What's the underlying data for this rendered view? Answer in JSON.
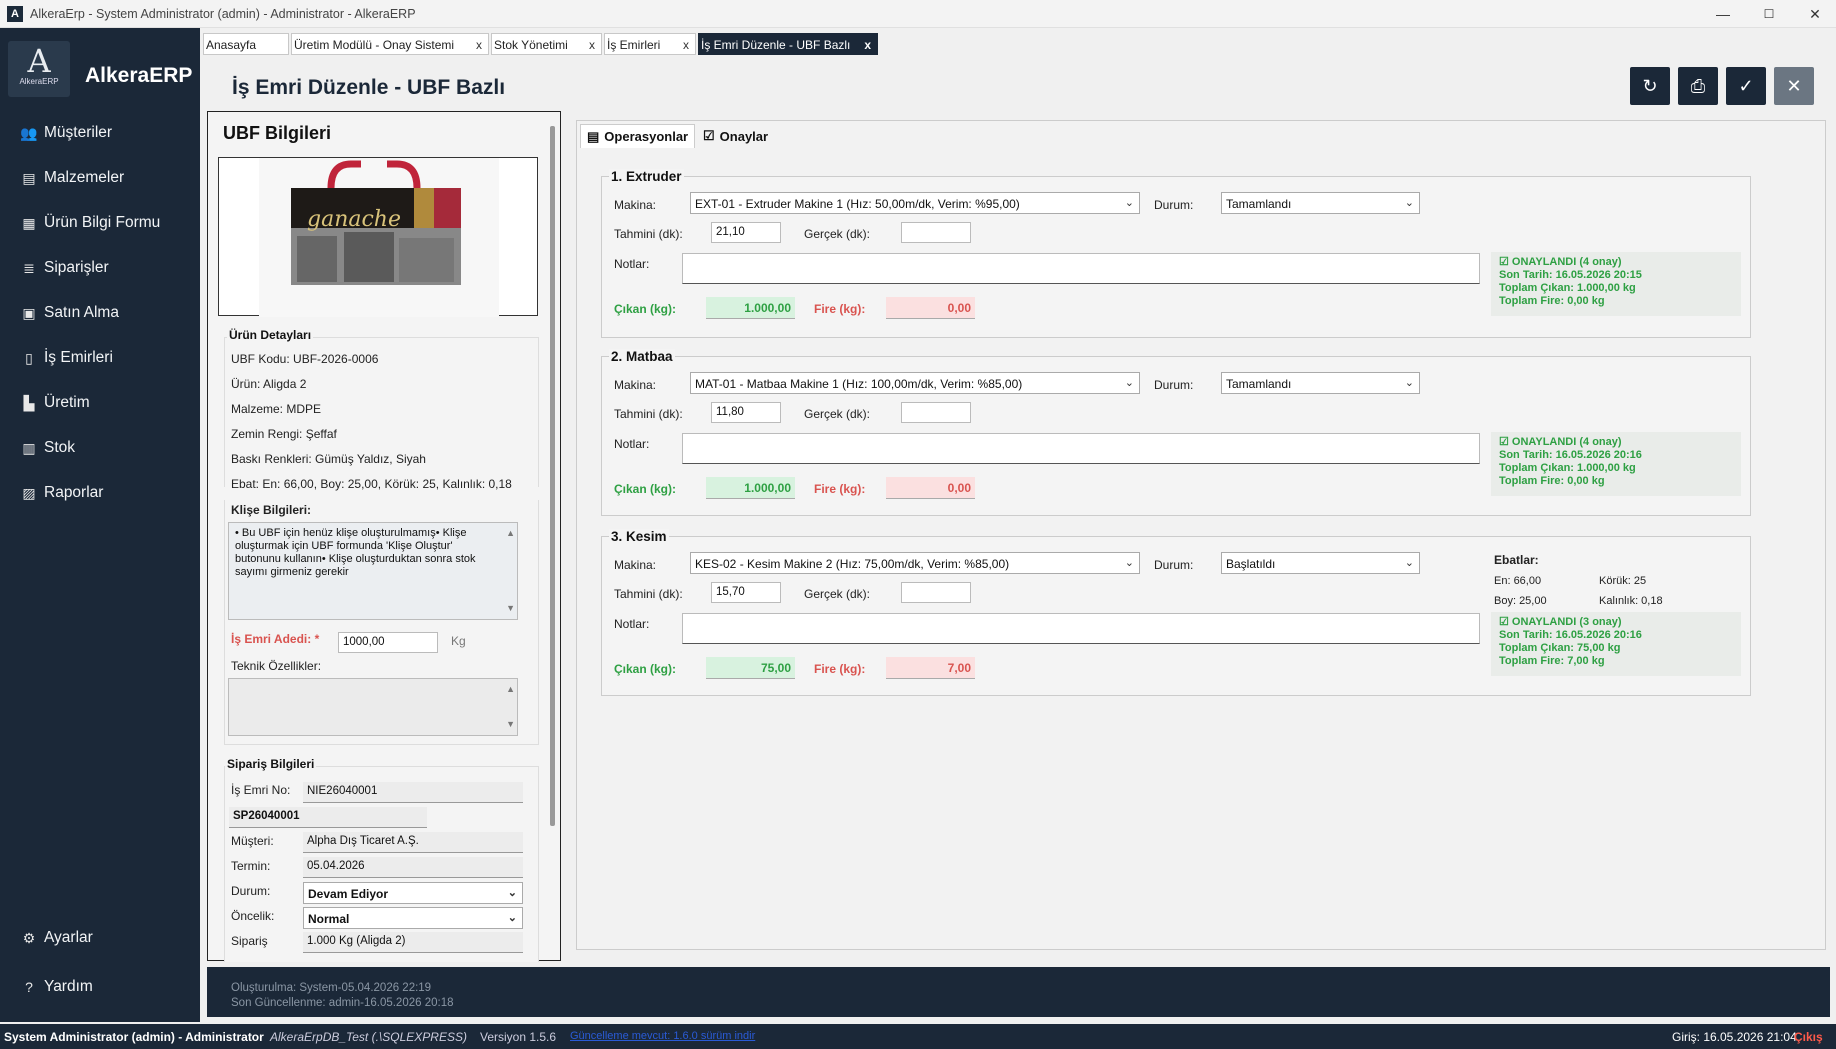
{
  "window": {
    "title": "AlkeraErp - System Administrator (admin) - Administrator - AlkeraERP",
    "min": "—",
    "max": "☐",
    "close": "✕"
  },
  "sidebar": {
    "logo_text": "AlkeraERP",
    "brand": "AlkeraERP",
    "items": [
      {
        "label": "Müşteriler",
        "icon": "users-icon"
      },
      {
        "label": "Malzemeler",
        "icon": "box-icon"
      },
      {
        "label": "Ürün Bilgi Formu",
        "icon": "form-icon"
      },
      {
        "label": "Siparişler",
        "icon": "orders-icon"
      },
      {
        "label": "Satın Alma",
        "icon": "cart-icon"
      },
      {
        "label": "İş Emirleri",
        "icon": "clipboard-icon"
      },
      {
        "label": "Üretim",
        "icon": "factory-icon"
      },
      {
        "label": "Stok",
        "icon": "stock-icon"
      },
      {
        "label": "Raporlar",
        "icon": "chart-icon"
      }
    ],
    "settings": "Ayarlar",
    "help": "Yardım"
  },
  "tabs": [
    {
      "label": "Anasayfa",
      "close": ""
    },
    {
      "label": "Üretim Modülü - Onay Sistemi",
      "close": "x"
    },
    {
      "label": "Stok Yönetimi",
      "close": "x"
    },
    {
      "label": "İş Emirleri",
      "close": "x"
    },
    {
      "label": "İş Emri Düzenle - UBF Bazlı",
      "close": "x"
    }
  ],
  "page": {
    "title": "İş Emri Düzenle - UBF Bazlı"
  },
  "ubf": {
    "header": "UBF Bilgileri",
    "details_title": "Ürün Detayları",
    "lines": [
      "UBF Kodu: UBF-2026-0006",
      "Ürün: Aligda 2",
      "Malzeme: MDPE",
      "Zemin Rengi: Şeffaf",
      "Baskı Renkleri: Gümüş Yaldız, Siyah",
      "Ebat: En: 66,00, Boy: 25,00, Körük: 25, Kalınlık: 0,18"
    ],
    "klise_label": "Klişe Bilgileri:",
    "klise_text": "• Bu UBF için henüz klişe oluşturulmamış• Klişe oluşturmak için UBF formunda 'Klişe Oluştur' butonunu kullanın• Klişe oluşturduktan sonra stok sayımı girmeniz gerekir",
    "qty_label": "İş Emri Adedi: *",
    "qty_value": "1000,00",
    "qty_unit": "Kg",
    "tech_label": "Teknik Özellikler:"
  },
  "siparis": {
    "title": "Sipariş Bilgileri",
    "is_emri_label": "İş Emri No:",
    "is_emri_value": "NIE26040001",
    "siparis_no": "SP26040001",
    "musteri_label": "Müşteri:",
    "musteri_value": "Alpha Dış Ticaret A.Ş.",
    "termin_label": "Termin:",
    "termin_value": "05.04.2026",
    "durum_label": "Durum:",
    "durum_value": "Devam Ediyor",
    "oncelik_label": "Öncelik:",
    "oncelik_value": "Normal",
    "siparis_label": "Sipariş",
    "siparis_value": "1.000 Kg (Aligda 2)"
  },
  "right_tabs": {
    "operasyonlar": "Operasyonlar",
    "onaylar": "Onaylar"
  },
  "labels": {
    "makina": "Makina:",
    "durum": "Durum:",
    "tahmini": "Tahmini (dk):",
    "gercek": "Gerçek (dk):",
    "notlar": "Notlar:",
    "cikan": "Çıkan (kg):",
    "fire": "Fire (kg):"
  },
  "ops": [
    {
      "title": "1. Extruder",
      "makina": "EXT-01 - Extruder Makine 1 (Hız: 50,00m/dk, Verim: %95,00)",
      "durum": "Tamamlandı",
      "tahmini": "21,10",
      "gercek": "",
      "cikan": "1.000,00",
      "fire": "0,00",
      "approval": [
        "☑ ONAYLANDI (4 onay)",
        "Son Tarih: 16.05.2026 20:15",
        "Toplam Çıkan: 1.000,00 kg",
        "Toplam Fire: 0,00 kg"
      ]
    },
    {
      "title": "2. Matbaa",
      "makina": "MAT-01 - Matbaa Makine 1 (Hız: 100,00m/dk, Verim: %85,00)",
      "durum": "Tamamlandı",
      "tahmini": "11,80",
      "gercek": "",
      "cikan": "1.000,00",
      "fire": "0,00",
      "approval": [
        "☑ ONAYLANDI (4 onay)",
        "Son Tarih: 16.05.2026 20:16",
        "Toplam Çıkan: 1.000,00 kg",
        "Toplam Fire: 0,00 kg"
      ]
    },
    {
      "title": "3. Kesim",
      "makina": "KES-02 - Kesim Makine 2 (Hız: 75,00m/dk, Verim: %85,00)",
      "durum": "Başlatıldı",
      "tahmini": "15,70",
      "gercek": "",
      "cikan": "75,00",
      "fire": "7,00",
      "approval": [
        "☑ ONAYLANDI (3 onay)",
        "Son Tarih: 16.05.2026 20:16",
        "Toplam Çıkan: 75,00 kg",
        "Toplam Fire: 7,00 kg"
      ],
      "ebatlar": {
        "title": "Ebatlar:",
        "en": "En: 66,00",
        "koruk": "Körük: 25",
        "boy": "Boy: 25,00",
        "kalinlik": "Kalınlık: 0,18"
      }
    }
  ],
  "footer": {
    "created": "Oluşturulma: System-05.04.2026 22:19",
    "updated": "Son Güncellenme: admin-16.05.2026 20:18"
  },
  "status": {
    "user": "System Administrator (admin) - Administrator",
    "db": "AlkeraErpDB_Test (.\\SQLEXPRESS)",
    "version": "Versiyon 1.5.6",
    "link": "Güncelleme mevcut: 1.6.0 sürüm indir",
    "login": "Giriş: 16.05.2026 21:04",
    "logout": "Çıkış"
  }
}
